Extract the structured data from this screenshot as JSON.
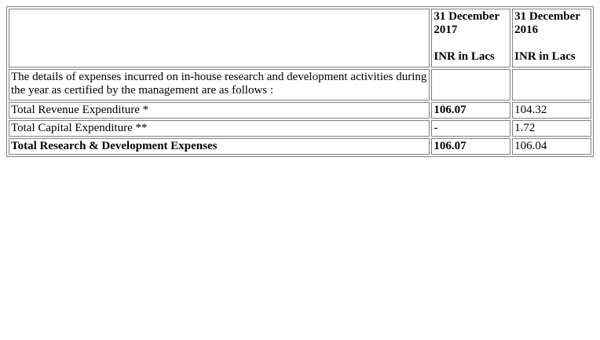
{
  "table": {
    "header": {
      "col_2017": {
        "date": "31 December",
        "year": "2017",
        "unit": "INR in Lacs"
      },
      "col_2016": {
        "date": "31 December",
        "year": "2016",
        "unit": "INR in Lacs"
      }
    },
    "description": "The details of expenses incurred on in-house research and development activities during the year as certified by the management are as follows :",
    "rows": [
      {
        "label": "Total Revenue Expenditure *",
        "v2017": "106.07",
        "v2016": "104.32"
      },
      {
        "label": "Total Capital Expenditure **",
        "v2017": "-",
        "v2016": "1.72"
      },
      {
        "label": "Total Research & Development Expenses",
        "v2017": "106.07",
        "v2016": "106.04"
      }
    ]
  }
}
